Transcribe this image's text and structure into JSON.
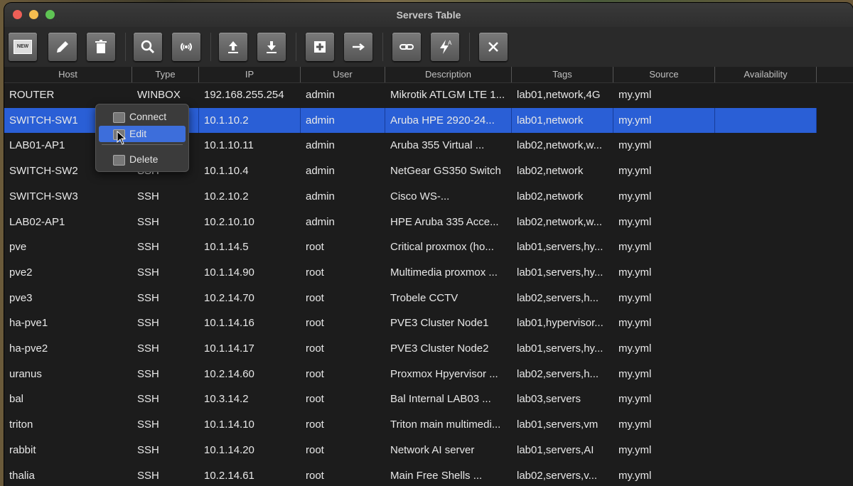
{
  "window": {
    "title": "Servers Table"
  },
  "toolbar": {
    "buttons": [
      {
        "name": "new",
        "icon": "new-icon"
      },
      {
        "name": "edit",
        "icon": "pencil-icon"
      },
      {
        "name": "delete",
        "icon": "trash-icon"
      },
      {
        "name": "search",
        "icon": "search-icon"
      },
      {
        "name": "scan",
        "icon": "broadcast-icon"
      },
      {
        "name": "upload",
        "icon": "upload-icon"
      },
      {
        "name": "download",
        "icon": "download-icon"
      },
      {
        "name": "add",
        "icon": "plus-icon"
      },
      {
        "name": "forward",
        "icon": "arrow-right-icon"
      },
      {
        "name": "link",
        "icon": "link-icon"
      },
      {
        "name": "flash",
        "icon": "flash-icon"
      },
      {
        "name": "close",
        "icon": "close-icon"
      }
    ],
    "new_label": "NEW"
  },
  "table": {
    "columns": [
      "Host",
      "Type",
      "IP",
      "User",
      "Description",
      "Tags",
      "Source",
      "Availability"
    ],
    "rows": [
      [
        "ROUTER",
        "WINBOX",
        "192.168.255.254",
        "admin",
        "Mikrotik ATLGM LTE 1...",
        "lab01,network,4G",
        "my.yml",
        ""
      ],
      [
        "SWITCH-SW1",
        "",
        "10.1.10.2",
        "admin",
        "Aruba HPE 2920-24...",
        "lab01,network",
        "my.yml",
        ""
      ],
      [
        "LAB01-AP1",
        "",
        "10.1.10.11",
        "admin",
        "Aruba 355 Virtual ...",
        "lab02,network,w...",
        "my.yml",
        ""
      ],
      [
        "SWITCH-SW2",
        "SSH",
        "10.1.10.4",
        "admin",
        "NetGear GS350 Switch",
        "lab02,network",
        "my.yml",
        ""
      ],
      [
        "SWITCH-SW3",
        "SSH",
        "10.2.10.2",
        "admin",
        "Cisco WS-...",
        "lab02,network",
        "my.yml",
        ""
      ],
      [
        "LAB02-AP1",
        "SSH",
        "10.2.10.10",
        "admin",
        "HPE Aruba 335 Acce...",
        "lab02,network,w...",
        "my.yml",
        ""
      ],
      [
        "pve",
        "SSH",
        "10.1.14.5",
        "root",
        "Critical proxmox (ho...",
        "lab01,servers,hy...",
        "my.yml",
        ""
      ],
      [
        "pve2",
        "SSH",
        "10.1.14.90",
        "root",
        "Multimedia proxmox ...",
        "lab01,servers,hy...",
        "my.yml",
        ""
      ],
      [
        "pve3",
        "SSH",
        "10.2.14.70",
        "root",
        "Trobele CCTV",
        "lab02,servers,h...",
        "my.yml",
        ""
      ],
      [
        "ha-pve1",
        "SSH",
        "10.1.14.16",
        "root",
        "PVE3 Cluster Node1",
        "lab01,hypervisor...",
        "my.yml",
        ""
      ],
      [
        "ha-pve2",
        "SSH",
        "10.1.14.17",
        "root",
        "PVE3 Cluster Node2",
        "lab01,servers,hy...",
        "my.yml",
        ""
      ],
      [
        "uranus",
        "SSH",
        "10.2.14.60",
        "root",
        "Proxmox Hpyervisor ...",
        "lab02,servers,h...",
        "my.yml",
        ""
      ],
      [
        "bal",
        "SSH",
        "10.3.14.2",
        "root",
        "Bal Internal LAB03 ...",
        "lab03,servers",
        "my.yml",
        ""
      ],
      [
        "triton",
        "SSH",
        "10.1.14.10",
        "root",
        "Triton main multimedi...",
        "lab01,servers,vm",
        "my.yml",
        ""
      ],
      [
        "rabbit",
        "SSH",
        "10.1.14.20",
        "root",
        "Network AI server",
        "lab01,servers,AI",
        "my.yml",
        ""
      ],
      [
        "thalia",
        "SSH",
        "10.2.14.61",
        "root",
        "Main Free Shells ...",
        "lab02,servers,v...",
        "my.yml",
        ""
      ]
    ],
    "selected_row": 1,
    "selected_color": "#2a5fd6"
  },
  "context_menu": {
    "items": [
      {
        "label": "Connect",
        "icon": "connect-icon"
      },
      {
        "label": "Edit",
        "icon": "edit-icon",
        "active": true
      },
      {
        "label": "Delete",
        "icon": "delete-icon"
      }
    ]
  }
}
